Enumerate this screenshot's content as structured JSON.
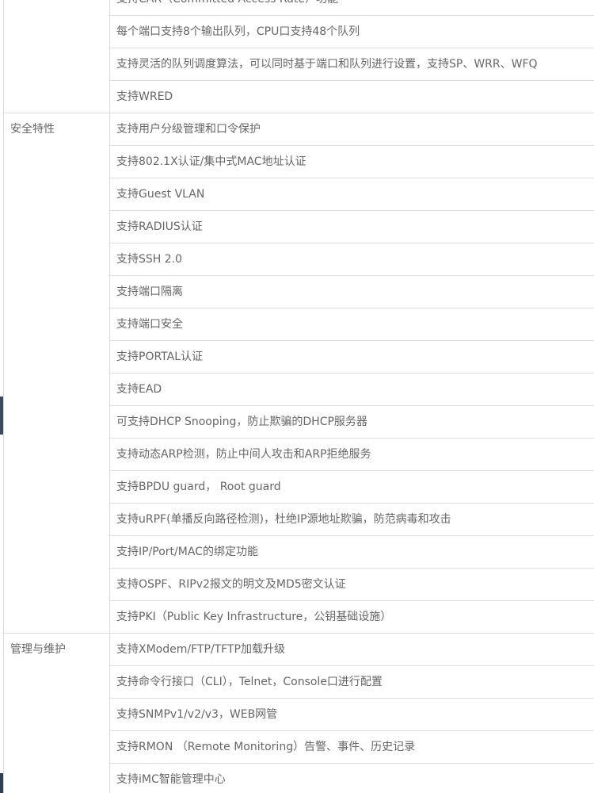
{
  "qos_tail": {
    "rows": [
      "支持CAR（Committed Access Rate）功能",
      "每个端口支持8个输出队列，CPU口支持48个队列",
      "支持灵活的队列调度算法，可以同时基于端口和队列进行设置，支持SP、WRR、WFQ",
      "支持WRED"
    ]
  },
  "security": {
    "label": "安全特性",
    "rows": [
      "支持用户分级管理和口令保护",
      "支持802.1X认证/集中式MAC地址认证",
      "支持Guest VLAN",
      "支持RADIUS认证",
      "支持SSH 2.0",
      "支持端口隔离",
      "支持端口安全",
      "支持PORTAL认证",
      "支持EAD",
      "可支持DHCP Snooping，防止欺骗的DHCP服务器",
      "支持动态ARP检测，防止中间人攻击和ARP拒绝服务",
      "支持BPDU guard， Root guard",
      "支持uRPF(单播反向路径检测)，杜绝IP源地址欺骗，防范病毒和攻击",
      "支持IP/Port/MAC的绑定功能",
      "支持OSPF、RIPv2报文的明文及MD5密文认证",
      "支持PKI（Public Key Infrastructure，公钥基础设施）"
    ]
  },
  "management": {
    "label": "管理与维护",
    "rows": [
      "支持XModem/FTP/TFTP加载升级",
      "支持命令行接口（CLI），Telnet，Console口进行配置",
      "支持SNMPv1/v2/v3，WEB网管",
      "支持RMON （Remote Monitoring）告警、事件、历史记录",
      "支持iMC智能管理中心"
    ]
  }
}
